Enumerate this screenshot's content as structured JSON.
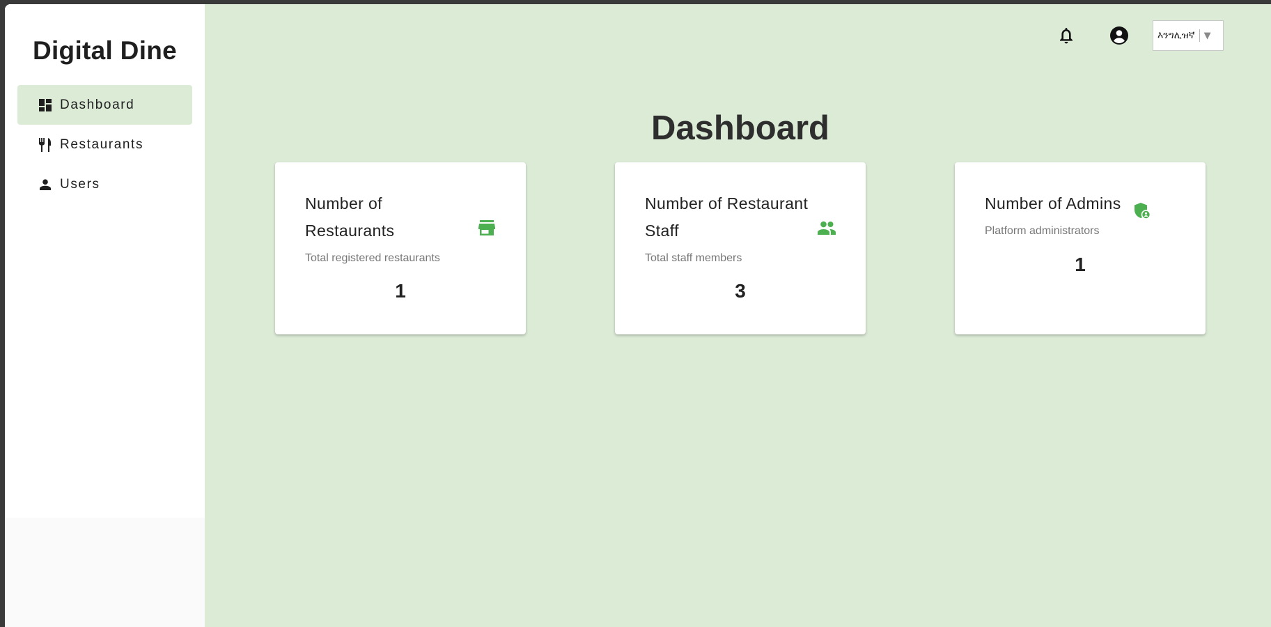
{
  "app": {
    "title": "Digital Dine"
  },
  "sidebar": {
    "items": [
      {
        "label": "Dashboard",
        "icon": "dashboard-icon",
        "active": true
      },
      {
        "label": "Restaurants",
        "icon": "restaurant-icon",
        "active": false
      },
      {
        "label": "Users",
        "icon": "person-icon",
        "active": false
      }
    ]
  },
  "header": {
    "notifications_icon": "bell-icon",
    "account_icon": "account-circle-icon",
    "language": "እንግሊዝኛ",
    "language_arrow": "▼"
  },
  "main": {
    "title": "Dashboard",
    "cards": [
      {
        "title_line1": "Number of",
        "title_line2": "Restaurants",
        "subtitle": "Total registered restaurants",
        "value": "1",
        "icon": "store-icon"
      },
      {
        "title_line1": "Number of Restaurant",
        "title_line2": "Staff",
        "subtitle": "Total staff members",
        "value": "3",
        "icon": "people-icon"
      },
      {
        "title_line1": "Number of Admins",
        "subtitle": "Platform administrators",
        "value": "1",
        "icon": "admin-shield-icon"
      }
    ]
  },
  "colors": {
    "accent_green": "#4caf50",
    "background": "#dbebd6",
    "sidebar": "#ffffff"
  }
}
